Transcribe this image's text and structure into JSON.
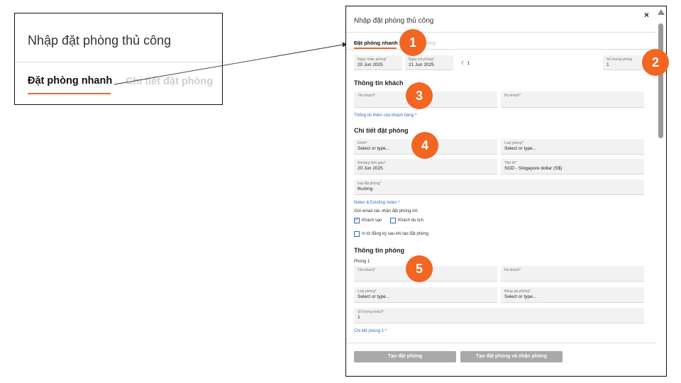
{
  "zoom": {
    "title": "Nhập đặt phòng thủ công",
    "tab_quick": "Đặt phòng nhanh",
    "tab_detail": "Chi tiết đặt phòng"
  },
  "dialog": {
    "title": "Nhập đặt phòng thủ công",
    "close": "×",
    "tabs": {
      "quick": "Đặt phòng nhanh",
      "detail": "phòng"
    },
    "dates": {
      "checkin_label": "Ngày nhận phòng*",
      "checkin_value": "20 Jun 2025",
      "checkout_label": "Ngày trả phòng*",
      "checkout_value": "21 Jun 2025",
      "nights": "1",
      "rooms_label": "Số lượng phòng",
      "rooms_value": "1"
    },
    "guest": {
      "title": "Thông tin khách",
      "firstname_label": "Tên khách*",
      "lastname_label": "Họ khách*",
      "more_link": "Thông tin thêm của khách hàng"
    },
    "booking": {
      "title": "Chi tiết đặt phòng",
      "channel_label": "Kênh*",
      "channel_value": "Select or type...",
      "roomtype_label": "Loại phòng*",
      "roomtype_value": "Select or type...",
      "period_label": "Khoảng thời gian*",
      "period_value": "20 Jun 2025",
      "currency_label": "Tiền tệ*",
      "currency_value": "SGD - Singapore dollar (S$)",
      "btype_label": "loại đặt phòng*",
      "btype_value": "thường",
      "notes_link": "Notes & Existing notes",
      "email_label": "Gửi email xác nhận đặt phòng tới:",
      "cb_hotel": "Khách sạn",
      "cb_traveler": "Khách du lịch",
      "cb_print": "In tờ đăng ký sau khi tạo đặt phòng"
    },
    "room": {
      "title": "Thông tin phòng",
      "room1": "Phòng 1",
      "firstname_label": "Tên khách*",
      "lastname_label": "Họ khách*",
      "roomtype_label": "Loại phòng*",
      "roomtype_value": "Select or type...",
      "rateplan_label": "Bảng giá phòng*",
      "rateplan_value": "Select or type...",
      "guests_label": "Số lượng khách*",
      "guests_value": "1",
      "detail_link": "Chi tiết phòng 1"
    },
    "buttons": {
      "create": "Tạo đặt phòng",
      "create_checkin": "Tạo đặt phòng và nhận phòng"
    }
  },
  "badges": [
    "1",
    "2",
    "3",
    "4",
    "5"
  ],
  "colors": {
    "accent": "#e96b2f",
    "badge": "#f26522",
    "link": "#2a6db5",
    "button": "#a9a9a9"
  }
}
